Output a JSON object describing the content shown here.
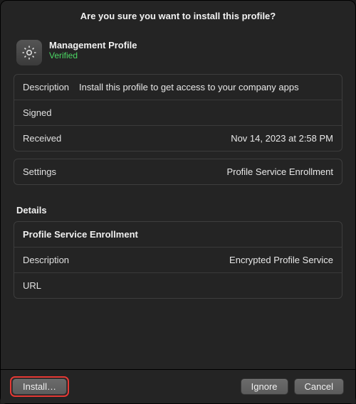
{
  "dialog": {
    "title": "Are you sure you want to install this profile?"
  },
  "profile": {
    "icon": "gear-icon",
    "name": "Management Profile",
    "status": "Verified"
  },
  "info_panel": {
    "description_label": "Description",
    "description_value": "Install this profile to get access to your company apps",
    "signed_label": "Signed",
    "signed_value": "",
    "received_label": "Received",
    "received_value": "Nov 14, 2023 at 2:58 PM"
  },
  "settings_panel": {
    "label": "Settings",
    "value": "Profile Service Enrollment"
  },
  "details": {
    "section_title": "Details",
    "heading": "Profile Service Enrollment",
    "description_label": "Description",
    "description_value": "Encrypted Profile Service",
    "url_label": "URL",
    "url_value": ""
  },
  "buttons": {
    "install": "Install…",
    "ignore": "Ignore",
    "cancel": "Cancel"
  }
}
